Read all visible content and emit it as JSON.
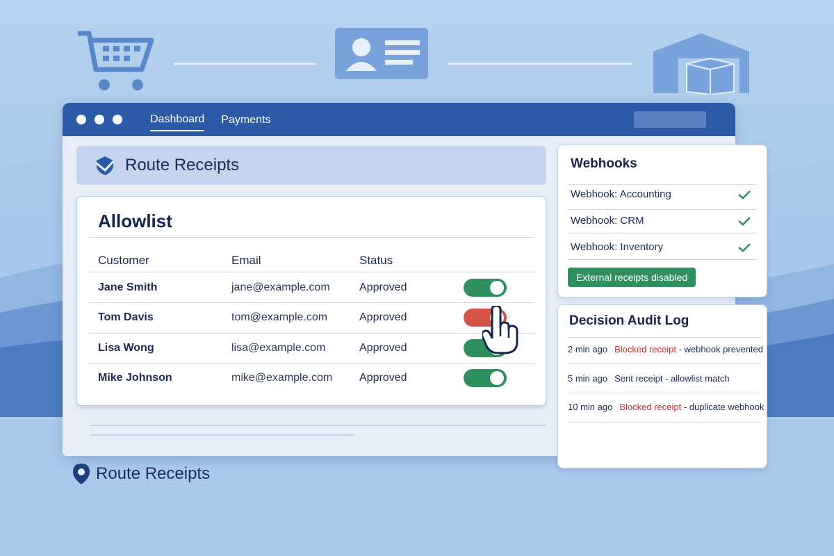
{
  "window": {
    "tabs": [
      {
        "label": "Dashboard",
        "active": true
      },
      {
        "label": "Payments",
        "active": false
      }
    ]
  },
  "header": {
    "title": "Route Receipts"
  },
  "allowlist": {
    "title": "Allowlist",
    "columns": [
      "Customer",
      "Email",
      "Status"
    ],
    "rows": [
      {
        "customer": "Jane Smith",
        "email": "jane@example.com",
        "status": "Approved",
        "toggle": "on"
      },
      {
        "customer": "Tom Davis",
        "email": "tom@example.com",
        "status": "Approved",
        "toggle": "off"
      },
      {
        "customer": "Lisa Wong",
        "email": "lisa@example.com",
        "status": "Approved",
        "toggle": "on"
      },
      {
        "customer": "Mike Johnson",
        "email": "mike@example.com",
        "status": "Approved",
        "toggle": "on"
      }
    ]
  },
  "webhooks": {
    "title": "Webhooks",
    "items": [
      {
        "label": "Webhook: Accounting",
        "checked": true
      },
      {
        "label": "Webhook: CRM",
        "checked": true
      },
      {
        "label": "Webhook: Inventory",
        "checked": true
      }
    ],
    "status_pill": "External receipts disabled"
  },
  "audit": {
    "title": "Decision Audit Log",
    "entries": [
      {
        "time": "2 min ago",
        "highlight": "Blocked receipt",
        "text": " - webhook prevented"
      },
      {
        "time": "5 min ago",
        "highlight": "",
        "text": "Sent receipt - allowlist match"
      },
      {
        "time": "10 min ago",
        "highlight": "Blocked receipt",
        "text": " - duplicate webhook"
      }
    ]
  },
  "brand": {
    "label": "Route Receipts"
  },
  "colors": {
    "accent": "#2c5aa6",
    "toggle_on": "#2f8f5d",
    "toggle_off": "#d4544a",
    "blocked_text": "#c9302c"
  },
  "icons": {
    "top_left": "shopping-cart-icon",
    "top_center": "contact-card-icon",
    "top_right": "warehouse-icon",
    "header": "shield-logo-icon",
    "brand": "location-pin-icon",
    "cursor": "hand-pointer-icon"
  }
}
